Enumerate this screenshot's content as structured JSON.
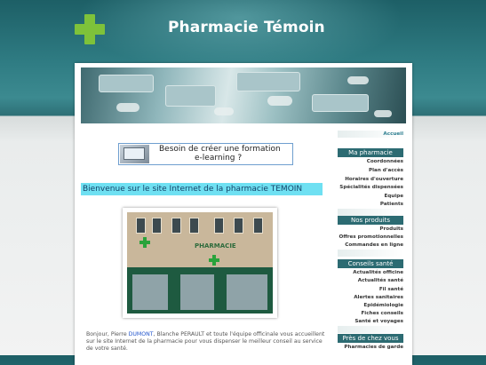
{
  "site": {
    "title": "Pharmacie Témoin"
  },
  "promo": {
    "line1": "Besoin de créer une formation",
    "line2": "e-learning ?"
  },
  "main": {
    "welcome_heading": "Bienvenue sur le site Internet de la pharmacie TEMOIN",
    "intro_before": "Bonjour, Pierre ",
    "intro_name": "DUMONT",
    "intro_after": ", Blanche PERAULT et toute l'équipe officinale vous accueillent sur le site Internet de la pharmacie pour vous dispenser le meilleur conseil au service de votre santé.",
    "storefront_sign": "PHARMACIE"
  },
  "sidebar": {
    "home": "Accueil",
    "sections": [
      {
        "title": "Ma pharmacie",
        "items": [
          "Coordonnées",
          "Plan d'accès",
          "Horaires d'ouverture",
          "Spécialités dispensées",
          "Equipe",
          "Patients"
        ]
      },
      {
        "title": "Nos produits",
        "items": [
          "Produits",
          "Offres promotionnelles",
          "Commandes en ligne"
        ]
      },
      {
        "title": "Conseils santé",
        "items": [
          "Actualités officine",
          "Actualités santé",
          "Fil santé",
          "Alertes sanitaires",
          "Epidémiologie",
          "Fiches conseils",
          "Santé et voyages"
        ]
      },
      {
        "title": "Près de chez vous",
        "items": [
          "Pharmacies de garde"
        ]
      }
    ]
  },
  "colors": {
    "accent": "#2c6b72",
    "cross": "#7ec23a",
    "heading_bg": "#6fe0f2",
    "link": "#2255cc"
  }
}
